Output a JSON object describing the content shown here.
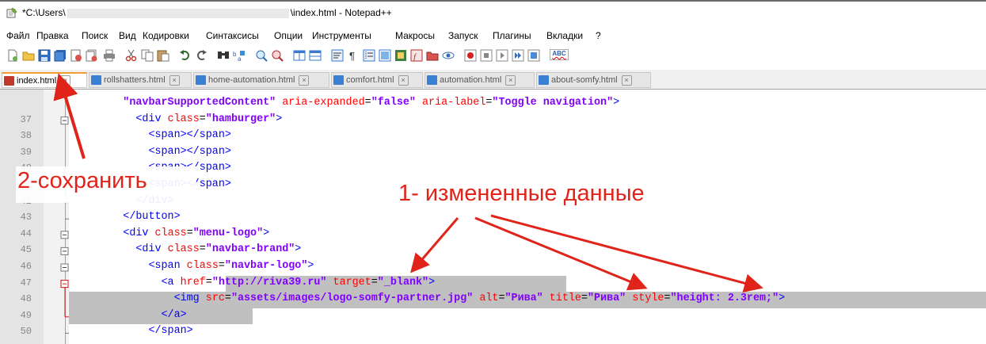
{
  "window": {
    "title_prefix": "*C:\\Users\\",
    "title_suffix": "\\index.html - Notepad++"
  },
  "menu": [
    "Файл",
    "Правка",
    "Поиск",
    "Вид",
    "Кодировки",
    "Синтаксисы",
    "Опции",
    "Инструменты",
    "Макросы",
    "Запуск",
    "Плагины",
    "Вкладки",
    "?"
  ],
  "toolbar": {
    "icons": [
      "new-icon",
      "open-icon",
      "save-icon",
      "save-all-icon",
      "close-icon",
      "close-all-icon",
      "print-icon",
      "cut-icon",
      "copy-icon",
      "paste-icon",
      "undo-icon",
      "redo-icon",
      "find-icon",
      "replace-icon",
      "zoom-in-icon",
      "zoom-out-icon",
      "sync-v-icon",
      "sync-h-icon",
      "wrap-icon",
      "all-chars-icon",
      "indent-guide-icon",
      "udl-icon",
      "doc-map-icon",
      "function-list-icon",
      "folder-icon",
      "monitor-icon",
      "record-icon",
      "stop-icon",
      "play-icon",
      "play-multi-icon",
      "save-macro-icon",
      "spellcheck-icon"
    ],
    "spellcheck_label": "ABC"
  },
  "tabs": [
    {
      "label": "index.html",
      "active": true
    },
    {
      "label": "rollshatters.html",
      "active": false
    },
    {
      "label": "home-automation.html",
      "active": false
    },
    {
      "label": "comfort.html",
      "active": false
    },
    {
      "label": "automation.html",
      "active": false
    },
    {
      "label": "about-somfy.html",
      "active": false
    }
  ],
  "editor": {
    "line_numbers": [
      "",
      "37",
      "38",
      "39",
      "40",
      "41",
      "42",
      "43",
      "44",
      "45",
      "46",
      "47",
      "48",
      "49",
      "50"
    ],
    "lines": [
      {
        "indent": "        ",
        "parts": [
          [
            "str",
            "\"navbarSupportedContent\""
          ],
          [
            "txt",
            " "
          ],
          [
            "attr",
            "aria-expanded"
          ],
          [
            "txt",
            "="
          ],
          [
            "str",
            "\"false\""
          ],
          [
            "txt",
            " "
          ],
          [
            "attr",
            "aria-label"
          ],
          [
            "txt",
            "="
          ],
          [
            "str",
            "\"Toggle navigation\""
          ],
          [
            "tag",
            ">"
          ]
        ]
      },
      {
        "indent": "          ",
        "parts": [
          [
            "tag",
            "<div"
          ],
          [
            "txt",
            " "
          ],
          [
            "attr",
            "class"
          ],
          [
            "txt",
            "="
          ],
          [
            "str",
            "\"hamburger\""
          ],
          [
            "tag",
            ">"
          ]
        ]
      },
      {
        "indent": "            ",
        "parts": [
          [
            "tag",
            "<span></span>"
          ]
        ]
      },
      {
        "indent": "            ",
        "parts": [
          [
            "tag",
            "<span></span>"
          ]
        ]
      },
      {
        "indent": "            ",
        "parts": [
          [
            "tag",
            "<span></span>"
          ]
        ]
      },
      {
        "indent": "            ",
        "parts": [
          [
            "tag",
            "<span></span>"
          ]
        ]
      },
      {
        "indent": "          ",
        "parts": [
          [
            "tag",
            "</div>"
          ]
        ]
      },
      {
        "indent": "        ",
        "parts": [
          [
            "tag",
            "</button>"
          ]
        ]
      },
      {
        "indent": "        ",
        "parts": [
          [
            "tag",
            "<div"
          ],
          [
            "txt",
            " "
          ],
          [
            "attr",
            "class"
          ],
          [
            "txt",
            "="
          ],
          [
            "str",
            "\"menu-logo\""
          ],
          [
            "tag",
            ">"
          ]
        ]
      },
      {
        "indent": "          ",
        "parts": [
          [
            "tag",
            "<div"
          ],
          [
            "txt",
            " "
          ],
          [
            "attr",
            "class"
          ],
          [
            "txt",
            "="
          ],
          [
            "str",
            "\"navbar-brand\""
          ],
          [
            "tag",
            ">"
          ]
        ]
      },
      {
        "indent": "            ",
        "parts": [
          [
            "tag",
            "<span"
          ],
          [
            "txt",
            " "
          ],
          [
            "attr",
            "class"
          ],
          [
            "txt",
            "="
          ],
          [
            "str",
            "\"navbar-logo\""
          ],
          [
            "tag",
            ">"
          ]
        ]
      },
      {
        "indent": "              ",
        "parts": [
          [
            "tag",
            "<a"
          ],
          [
            "txt",
            " "
          ],
          [
            "attr",
            "href"
          ],
          [
            "txt",
            "="
          ],
          [
            "str",
            "\"http://riva39.ru\""
          ],
          [
            "txt",
            " "
          ],
          [
            "attr",
            "target"
          ],
          [
            "txt",
            "="
          ],
          [
            "str",
            "\"_blank\""
          ],
          [
            "tag",
            ">"
          ]
        ]
      },
      {
        "indent": "                ",
        "parts": [
          [
            "tag",
            "<img"
          ],
          [
            "txt",
            " "
          ],
          [
            "attr",
            "src"
          ],
          [
            "txt",
            "="
          ],
          [
            "str",
            "\"assets/images/logo-somfy-partner.jpg\""
          ],
          [
            "txt",
            " "
          ],
          [
            "attr",
            "alt"
          ],
          [
            "txt",
            "="
          ],
          [
            "str",
            "\"Рива\""
          ],
          [
            "txt",
            " "
          ],
          [
            "attr",
            "title"
          ],
          [
            "txt",
            "="
          ],
          [
            "str",
            "\"Рива\""
          ],
          [
            "txt",
            " "
          ],
          [
            "attr",
            "style"
          ],
          [
            "txt",
            "="
          ],
          [
            "str",
            "\"height: 2.3rem;\""
          ],
          [
            "tag",
            ">"
          ]
        ]
      },
      {
        "indent": "              ",
        "parts": [
          [
            "tag",
            "</a>"
          ]
        ]
      },
      {
        "indent": "            ",
        "parts": [
          [
            "tag",
            "</span>"
          ]
        ]
      }
    ]
  },
  "annotations": {
    "save": "2-сохранить",
    "changed": "1- измененные данные"
  },
  "colors": {
    "annotation": "#e0241a",
    "selection": "#c0c0c0",
    "tag": "#0000ff",
    "attribute": "#ff0000",
    "string": "#8000ff"
  }
}
